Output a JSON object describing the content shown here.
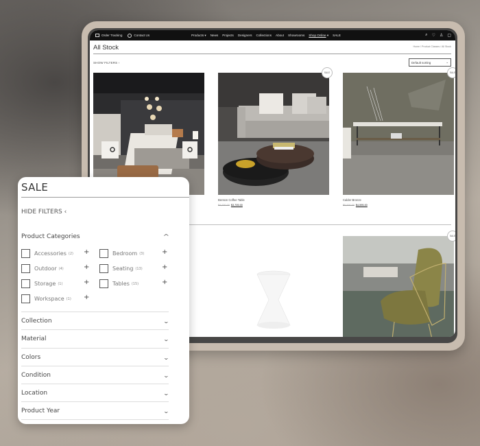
{
  "topbar": {
    "order_tracking": "Order Tracking",
    "contact_us": "Contact Us",
    "nav": [
      {
        "label": "Products",
        "dropdown": true
      },
      {
        "label": "News"
      },
      {
        "label": "Projects"
      },
      {
        "label": "Designers"
      },
      {
        "label": "Collections"
      },
      {
        "label": "About"
      },
      {
        "label": "Showrooms"
      },
      {
        "label": "Shop Online",
        "dropdown": true,
        "active": true
      },
      {
        "label": "SALE"
      }
    ],
    "icons": [
      "search-icon",
      "heart-icon",
      "user-icon",
      "cart-icon"
    ]
  },
  "page": {
    "title": "All Stock",
    "breadcrumb": "Home / Product Classes / All Stock",
    "show_filters": "SHOW FILTERS ›",
    "sorting": "Default sorting"
  },
  "products": [
    {
      "name": "",
      "image": "bedroom scene",
      "sale": false
    },
    {
      "name": "Benson Coffee Table",
      "old_price": "$4,000.00",
      "price": "$3,705.00",
      "image": "coffee table and sofa",
      "sale": true,
      "sale_label": "SALE"
    },
    {
      "name": "Calder Bronze",
      "old_price": "$5,000.00",
      "price": "$4,595.00",
      "image": "console table",
      "sale": true,
      "sale_label": "SALE"
    },
    {
      "name": "",
      "image": "white side stool",
      "sale": false
    },
    {
      "name": "",
      "image": "armchair",
      "sale": true,
      "sale_label": "SALE"
    }
  ],
  "filters": {
    "title": "SALE",
    "hide_filters": "HIDE FILTERS",
    "categories_heading": "Product Categories",
    "categories": [
      {
        "label": "Accessories",
        "count": "(2)"
      },
      {
        "label": "Bedroom",
        "count": "(3)"
      },
      {
        "label": "Outdoor",
        "count": "(4)"
      },
      {
        "label": "Seating",
        "count": "(13)"
      },
      {
        "label": "Storage",
        "count": "(1)"
      },
      {
        "label": "Tables",
        "count": "(15)"
      },
      {
        "label": "Workspace",
        "count": "(1)"
      }
    ],
    "accordions": [
      "Collection",
      "Material",
      "Colors",
      "Condition",
      "Location",
      "Product Year"
    ]
  }
}
